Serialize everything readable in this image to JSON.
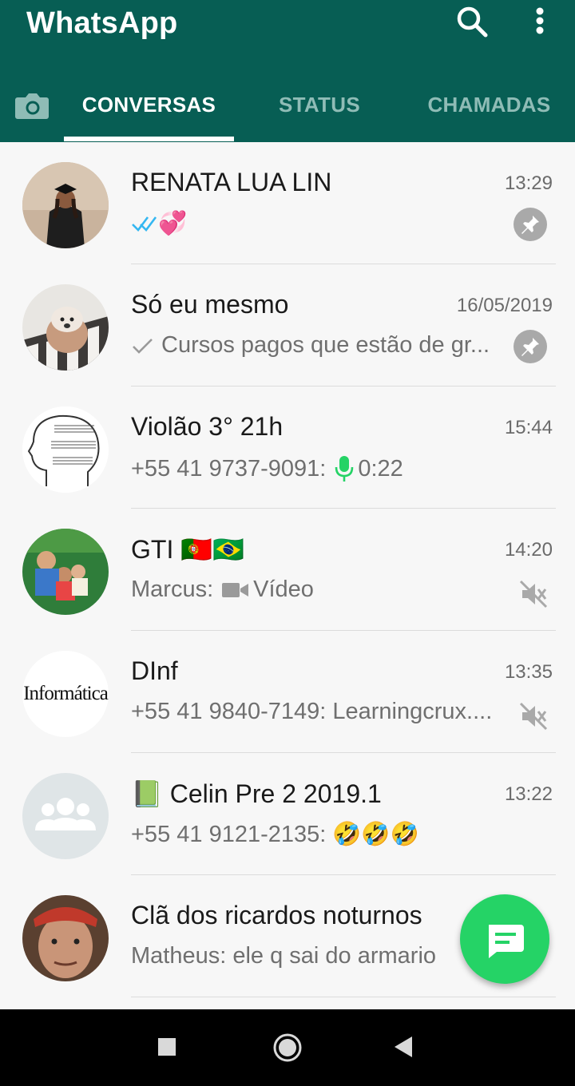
{
  "app": {
    "title": "WhatsApp"
  },
  "tabs": [
    {
      "label": "CONVERSAS",
      "active": true
    },
    {
      "label": "STATUS",
      "active": false
    },
    {
      "label": "CHAMADAS",
      "active": false
    }
  ],
  "chats": [
    {
      "name": "RENATA LUA LIN",
      "time": "13:29",
      "preview": "",
      "status_icon": "double-check-read-icon",
      "emoji": "💞",
      "pinned": true
    },
    {
      "name": "Só eu mesmo",
      "time": "16/05/2019",
      "preview": "Cursos pagos que estão de gr...",
      "status_icon": "single-check-icon",
      "pinned": true
    },
    {
      "name": "Violão 3° 21h",
      "time": "15:44",
      "preview_sender": "+55 41 9737-9091:",
      "preview": "0:22",
      "status_icon": "microphone-icon"
    },
    {
      "name": "GTI 🇵🇹🇧🇷",
      "time": "14:20",
      "preview_sender": "Marcus:",
      "preview": "Vídeo",
      "status_icon": "video-camera-icon",
      "muted": true
    },
    {
      "name": "DInf",
      "time": "13:35",
      "preview": "+55 41 9840-7149: Learningcrux....",
      "muted": true,
      "avatar_text": "Informática"
    },
    {
      "name": "📗 Celin Pre 2 2019.1",
      "time": "13:22",
      "preview_sender": "+55 41 9121-2135:",
      "preview": "🤣🤣🤣"
    },
    {
      "name": "Clã dos ricardos noturnos",
      "time": "",
      "preview": "Matheus: ele q sai do armario"
    }
  ],
  "colors": {
    "header": "#075e54",
    "accent": "#25d366",
    "tab_inactive": "#8fbcb6",
    "read_check": "#34b7f1"
  }
}
